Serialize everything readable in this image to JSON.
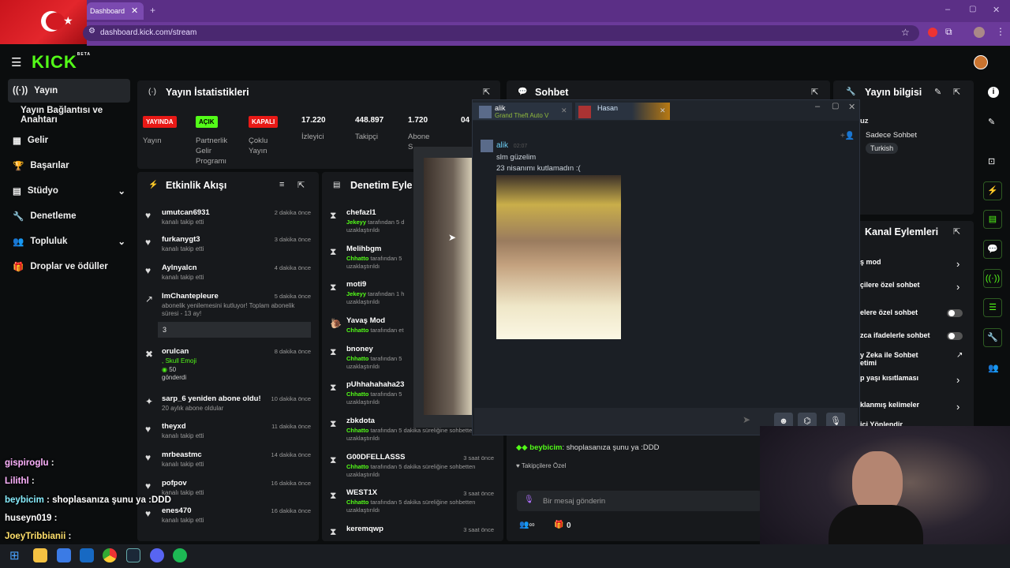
{
  "browser": {
    "tab_title": "Dashboard",
    "url": "dashboard.kick.com/stream"
  },
  "app": {
    "logo": "KICK",
    "logo_badge": "BETA"
  },
  "sidebar": {
    "items": [
      {
        "label": "Yayın"
      },
      {
        "label": "Yayın Bağlantısı ve Anahtarı"
      },
      {
        "label": "Gelir"
      },
      {
        "label": "Başarılar"
      },
      {
        "label": "Stüdyo"
      },
      {
        "label": "Denetleme"
      },
      {
        "label": "Topluluk"
      },
      {
        "label": "Droplar ve ödüller"
      }
    ]
  },
  "stats": {
    "title": "Yayın İstatistikleri",
    "badges": [
      {
        "text": "YAYINDA",
        "label": "Yayın",
        "color": "#e91916"
      },
      {
        "text": "AÇIK",
        "label": "Partnerlik Gelir Programı",
        "color": "#53fc18"
      },
      {
        "text": "KAPALI",
        "label": "Çoklu Yayın",
        "color": "#e91916"
      }
    ],
    "numbers": [
      {
        "value": "17.220",
        "label": "İzleyici"
      },
      {
        "value": "448.897",
        "label": "Takipçi"
      },
      {
        "value": "1.720",
        "label": "Abone S"
      },
      {
        "value": "04",
        "label": ""
      }
    ]
  },
  "activity": {
    "title": "Etkinlik Akışı",
    "items": [
      {
        "name": "umutcan6931",
        "sub": "kanalı takip etti",
        "time": "2 dakika önce"
      },
      {
        "name": "furkanygt3",
        "sub": "kanalı takip etti",
        "time": "3 dakika önce"
      },
      {
        "name": "Aylnyalcn",
        "sub": "kanalı takip etti",
        "time": "4 dakika önce"
      },
      {
        "name": "ImChantepleure",
        "sub": "abonelik yenilemesini kutluyor! Toplam abonelik süresi - 13 ay!",
        "time": "5 dakika önce",
        "message": "3"
      },
      {
        "name": "orulcan",
        "sub": ", Skull Emoji",
        "extra": "50",
        "extra2": "gönderdi",
        "time": "8 dakika önce"
      },
      {
        "name": "sarp_6 yeniden abone oldu!",
        "sub": "20 aylık abone oldular",
        "time": "10 dakika önce"
      },
      {
        "name": "theyxd",
        "sub": "kanalı takip etti",
        "time": "11 dakika önce"
      },
      {
        "name": "mrbeastmc",
        "sub": "kanalı takip etti",
        "time": "14 dakika önce"
      },
      {
        "name": "pofpov",
        "sub": "kanalı takip etti",
        "time": "16 dakika önce"
      },
      {
        "name": "enes470",
        "sub": "kanalı takip etti",
        "time": "16 dakika önce"
      }
    ]
  },
  "moderation": {
    "title": "Denetim Eyle",
    "items": [
      {
        "name": "chefazl1",
        "mod": "Jekeyy",
        "sub": "tarafından 5 d",
        "sub2": "uzaklaştırıldı",
        "time": ""
      },
      {
        "name": "Melihbgm",
        "mod": "Chhatto",
        "sub": "tarafından 5",
        "sub2": "uzaklaştırıldı",
        "time": ""
      },
      {
        "name": "moti9",
        "mod": "Jekeyy",
        "sub": "tarafından 1 h",
        "sub2": "uzaklaştırıldı",
        "time": ""
      },
      {
        "name": "Yavaş Mod",
        "mod": "Chhatto",
        "sub": "tarafından et",
        "sub2": "",
        "time": ""
      },
      {
        "name": "bnoney",
        "mod": "Chhatto",
        "sub": "tarafından 5",
        "sub2": "uzaklaştırıldı",
        "time": ""
      },
      {
        "name": "pUhhahahaha23",
        "mod": "Chhatto",
        "sub": "tarafından 5",
        "sub2": "uzaklaştırıldı",
        "time": ""
      },
      {
        "name": "zbkdota",
        "mod": "Chhatto",
        "sub": "tarafından 5 dakika süreliğine sohbetten",
        "sub2": "uzaklaştırıldı",
        "time": ""
      },
      {
        "name": "G00DFELLASSS",
        "mod": "Chhatto",
        "sub": "tarafından 5 dakika süreliğine sohbetten",
        "sub2": "uzaklaştırıldı",
        "time": "3 saat önce"
      },
      {
        "name": "WEST1X",
        "mod": "Chhatto",
        "sub": "tarafından 5 dakika süreliğine sohbetten",
        "sub2": "uzaklaştırıldı",
        "time": "3 saat önce"
      },
      {
        "name": "keremqwp",
        "mod": "",
        "sub": "",
        "sub2": "",
        "time": "3 saat önce"
      }
    ]
  },
  "chat": {
    "title": "Sohbet",
    "last_user": "beybicim",
    "last_msg": ": shoplasanıza şunu ya :DDD",
    "followers_only": "Takipçilere Özel",
    "placeholder": "Bir mesaj gönderin",
    "counter": "0"
  },
  "steam": {
    "tab1_name": "alik",
    "tab1_game": "Grand Theft Auto V",
    "tab2_name": "Hasan",
    "msg_user": "alik",
    "msg_time": "02:07",
    "msg_line1": "slm güzelim",
    "msg_line2": "23 nisanımı kutlamadın :("
  },
  "stream_info": {
    "title": "Yayın bilgisi",
    "line1": "uz",
    "category": "Sadece Sohbet",
    "language": "Turkish"
  },
  "channel_actions": {
    "title": "Kanal Eylemleri",
    "items": [
      {
        "label": "ş mod"
      },
      {
        "label": "çilere özel sohbet"
      },
      {
        "label": "elere özel sohbet"
      },
      {
        "label": "zca ifadelerle sohbet"
      },
      {
        "label": "y Zeka ile Sohbet",
        "label2": "etimi"
      },
      {
        "label": "p yaşı kısıtlaması"
      },
      {
        "label": "klanmış kelimeler"
      },
      {
        "label": "ici Yönlendir"
      }
    ]
  },
  "overlay_chat": [
    {
      "user": "gispiroglu",
      "text": " :"
    },
    {
      "user": "Lilithl",
      "text": " :"
    },
    {
      "user": "beybicim",
      "text": " : shoplasanıza şunu ya :DDD"
    },
    {
      "user": "huseyn019",
      "text": " :"
    },
    {
      "user": "JoeyTribbianii",
      "text": " :"
    }
  ],
  "colors": {
    "accent": "#53fc18",
    "live": "#e91916",
    "browser": "#5b2f86"
  }
}
